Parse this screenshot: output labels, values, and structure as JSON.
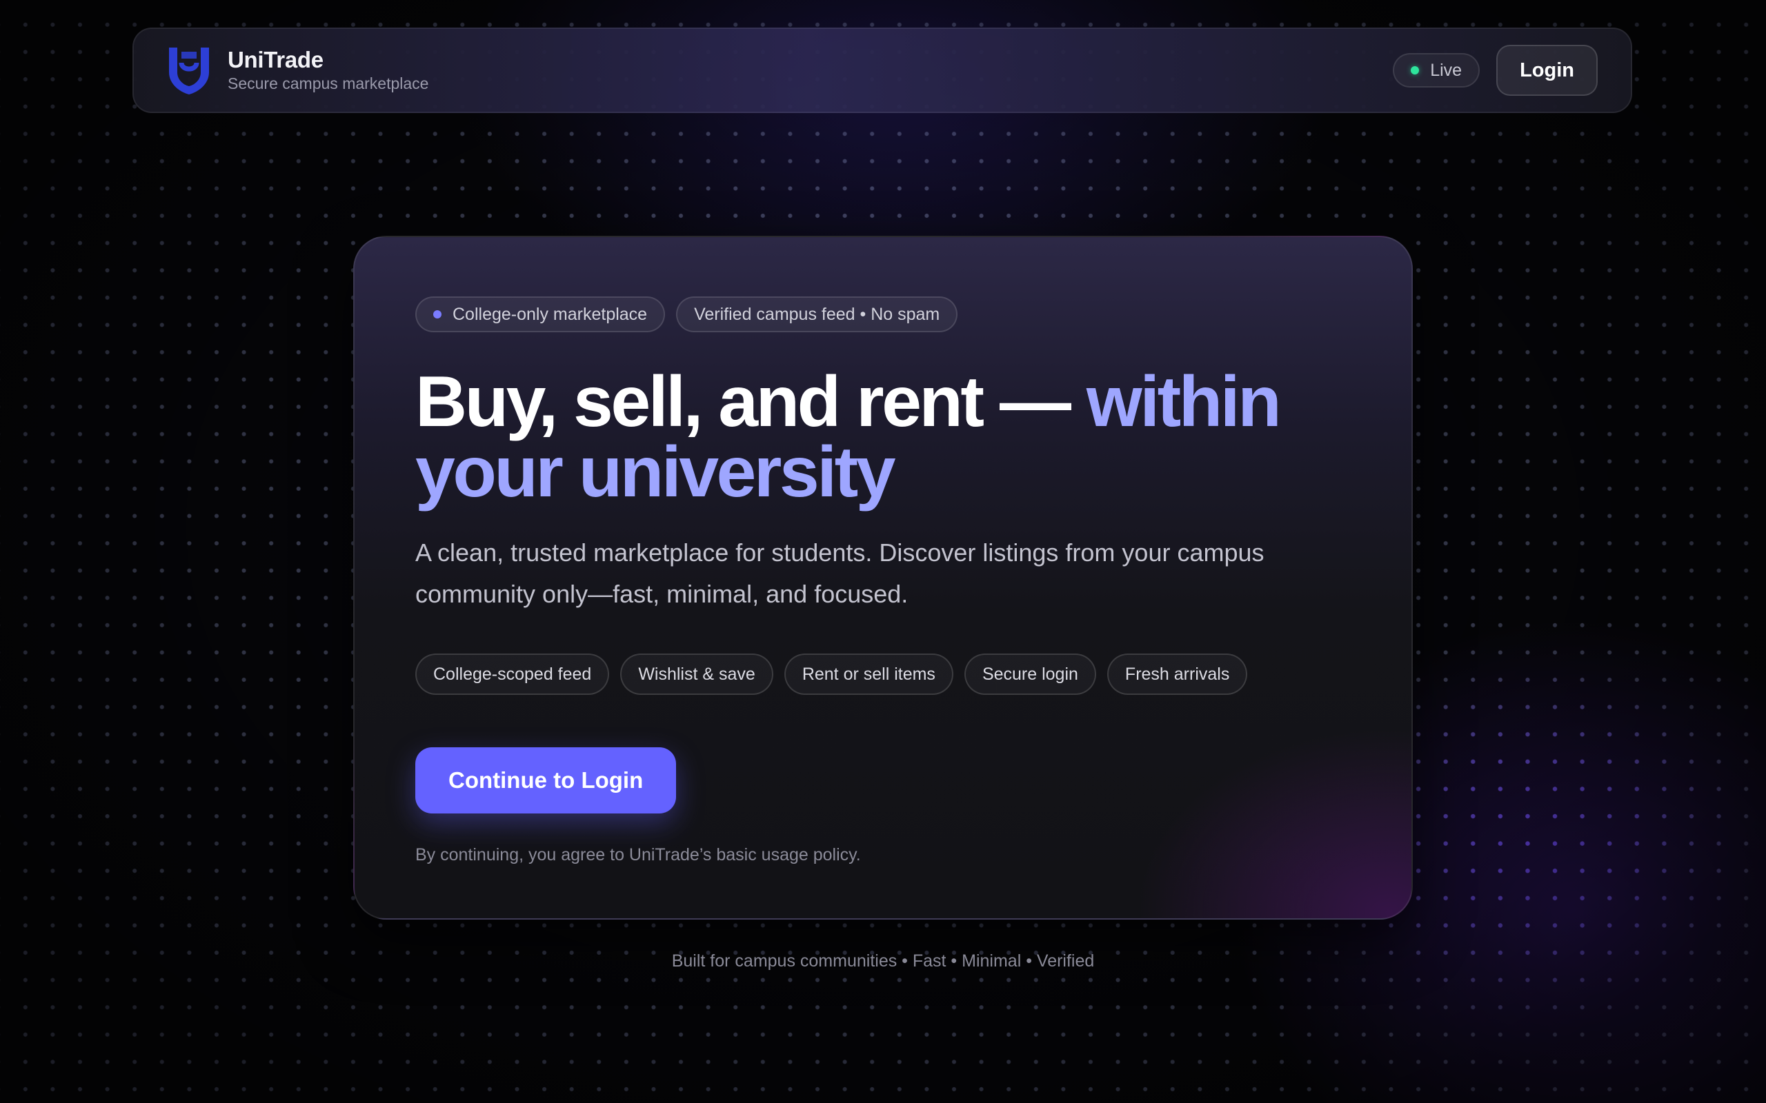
{
  "brand": {
    "name": "UniTrade",
    "tagline": "Secure campus marketplace",
    "logo_icon": "shield-u-icon",
    "logo_color": "#2d3fd6"
  },
  "nav": {
    "status_label": "Live",
    "status_color": "#2ee59d",
    "login_label": "Login"
  },
  "hero": {
    "badges": [
      {
        "label": "College-only marketplace",
        "has_dot": true
      },
      {
        "label": "Verified campus feed • No spam",
        "has_dot": false
      }
    ],
    "headline_main": "Buy, sell, and rent — ",
    "headline_accent": "within your university",
    "subtext": "A clean, trusted marketplace for students. Discover listings from your campus community only—fast, minimal, and focused.",
    "features": [
      "College-scoped feed",
      "Wishlist & save",
      "Rent or sell items",
      "Secure login",
      "Fresh arrivals"
    ],
    "cta_label": "Continue to Login",
    "policy_text": "By continuing, you agree to UniTrade’s basic usage policy."
  },
  "footer": {
    "text": "Built for campus communities • Fast • Minimal • Verified"
  },
  "colors": {
    "accent": "#6462ff",
    "headline_accent": "#9ea6ff",
    "background": "#060609"
  }
}
